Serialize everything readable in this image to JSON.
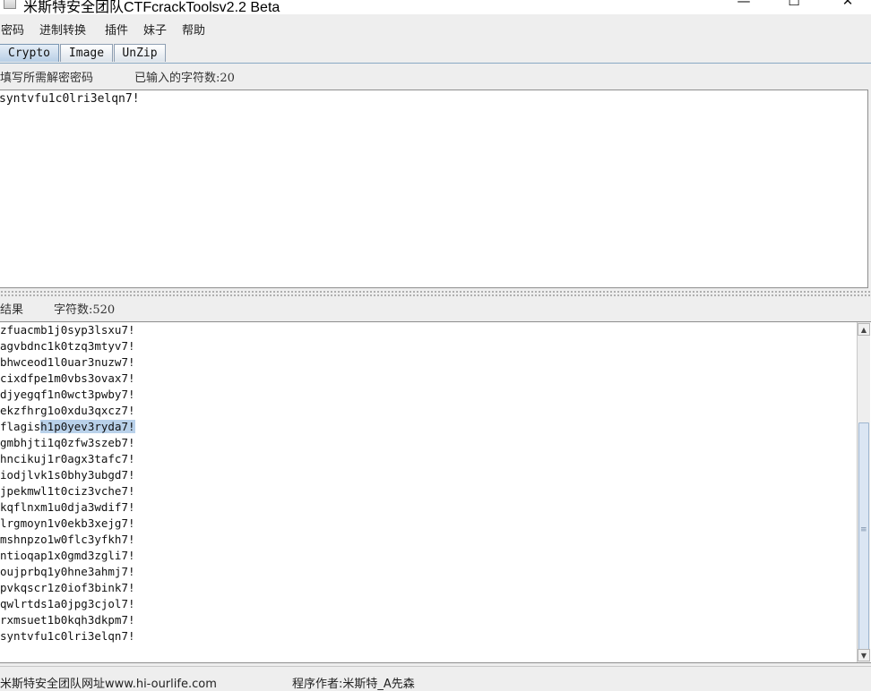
{
  "window": {
    "title": "米斯特安全团队CTFcrackToolsv2.2 Beta",
    "controls": {
      "minimize": "—",
      "maximize": "☐",
      "close": "✕"
    }
  },
  "menu": [
    "密码",
    "进制转换",
    "插件",
    "妹子",
    "帮助"
  ],
  "tabs": [
    "Crypto",
    "Image",
    "UnZip"
  ],
  "active_tab": "Crypto",
  "input": {
    "label": "填写所需解密密码",
    "count_label": "已输入的字符数:20",
    "value": "syntvfu1c0lri3elqn7!"
  },
  "result": {
    "label": "结果",
    "count_label": "字符数:520",
    "lines": [
      "zfuacmb1j0syp3lsxu7!",
      "agvbdnc1k0tzq3mtyv7!",
      "bhwceod1l0uar3nuzw7!",
      "cixdfpe1m0vbs3ovax7!",
      "djyegqf1n0wct3pwby7!",
      "ekzfhrg1o0xdu3qxcz7!",
      "flagish1p0yev3ryda7!",
      "gmbhjti1q0zfw3szeb7!",
      "hncikuj1r0agx3tafc7!",
      "iodjlvk1s0bhy3ubgd7!",
      "jpekmwl1t0ciz3vche7!",
      "kqflnxm1u0dja3wdif7!",
      "lrgmoyn1v0ekb3xejg7!",
      "mshnpzo1w0flc3yfkh7!",
      "ntioqap1x0gmd3zgli7!",
      "oujprbq1y0hne3ahmj7!",
      "pvkqscr1z0iof3bink7!",
      "qwlrtds1a0jpg3cjol7!",
      "rxmsuet1b0kqh3dkpm7!",
      "syntvfu1c0lri3elqn7!"
    ],
    "highlight": {
      "line": 6,
      "plain": "flagis",
      "selected": "h1p0yev3ryda7!"
    }
  },
  "scrollbar": {
    "up": "▲",
    "down": "▼",
    "grip": "≡"
  },
  "status": {
    "site": "米斯特安全团队网址www.hi-ourlife.com",
    "author": "程序作者:米斯特_A先森"
  }
}
